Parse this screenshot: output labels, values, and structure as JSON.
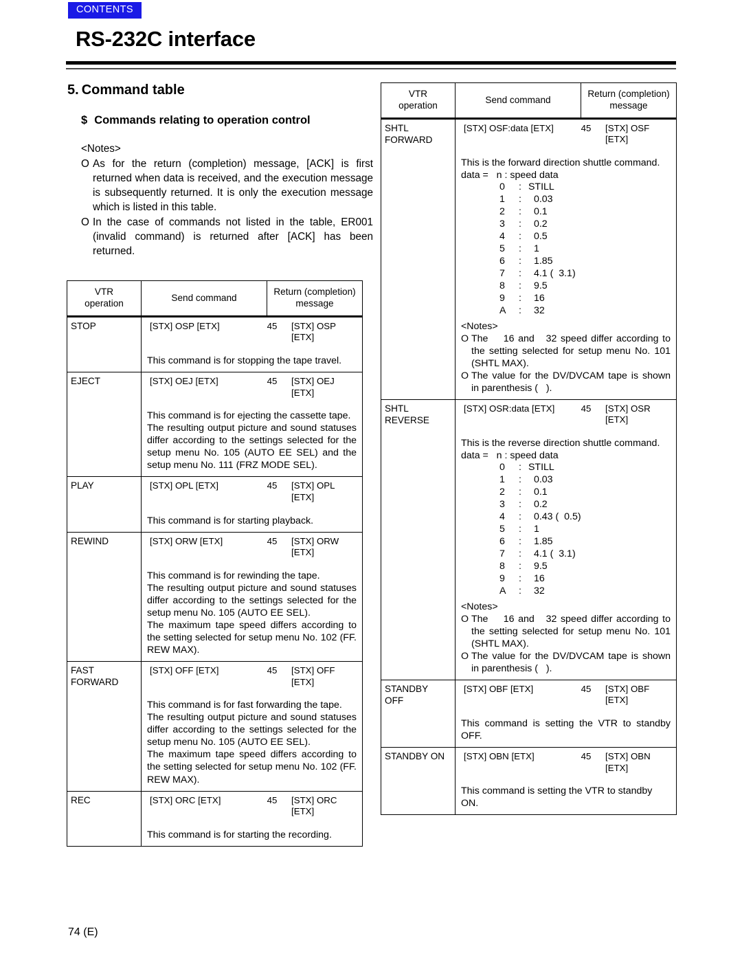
{
  "header": {
    "contents_badge": "CONTENTS",
    "title": "RS-232C interface"
  },
  "section": {
    "number": "5.",
    "heading": "Command table",
    "sub_bullet": "$",
    "sub_heading": "Commands relating to operation control"
  },
  "notes": {
    "title": "<Notes>",
    "mark": "O",
    "items": [
      "As for the return (completion) message, [ACK] is first returned when data is received, and the execution message is subsequently returned. It is only the execution message which is listed in this table.",
      "In the case of commands not listed in the table, ER001 (invalid command) is returned after [ACK] has been returned."
    ]
  },
  "table_header": {
    "col1_line1": "VTR",
    "col1_line2": "operation",
    "col2": "Send command",
    "col3_line1": "Return (completion)",
    "col3_line2": "message"
  },
  "arrow_symbol": "45",
  "left_table": {
    "rows": [
      {
        "operation": "STOP",
        "send": "[STX] OSP [ETX]",
        "arrow": "45",
        "return": "[STX] OSP [ETX]",
        "desc": [
          "This command is for stopping the tape travel."
        ]
      },
      {
        "operation": "EJECT",
        "send": "[STX] OEJ [ETX]",
        "arrow": "45",
        "return": "[STX] OEJ [ETX]",
        "desc": [
          "This command is for ejecting the cassette tape.",
          "The resulting output picture and sound statuses differ according to the settings selected for the setup menu No. 105 (AUTO EE SEL) and the setup menu No. 111 (FRZ MODE SEL)."
        ]
      },
      {
        "operation": "PLAY",
        "send": "[STX] OPL [ETX]",
        "arrow": "45",
        "return": "[STX] OPL [ETX]",
        "desc": [
          "This command is for starting playback."
        ]
      },
      {
        "operation": "REWIND",
        "send": "[STX] ORW [ETX]",
        "arrow": "45",
        "return": "[STX] ORW [ETX]",
        "desc": [
          "This command is for rewinding the tape.",
          "The resulting output picture and sound statuses differ according to the settings selected for the setup menu No. 105 (AUTO EE SEL).",
          "The maximum tape speed differs according to the setting selected for setup menu No. 102 (FF. REW MAX)."
        ]
      },
      {
        "operation": "FAST\nFORWARD",
        "send": "[STX] OFF [ETX]",
        "arrow": "45",
        "return": "[STX] OFF [ETX]",
        "desc": [
          "This command is for fast forwarding the tape.",
          "The resulting output picture and sound statuses differ according to the settings selected for the setup menu No. 105 (AUTO EE SEL).",
          "The maximum tape speed differs according to the setting selected for setup menu No. 102 (FF. REW MAX)."
        ]
      },
      {
        "operation": "REC",
        "send": "[STX] ORC [ETX]",
        "arrow": "45",
        "return": "[STX] ORC [ETX]",
        "desc": [
          "This command is for starting the recording."
        ]
      }
    ]
  },
  "right_table": {
    "rows": [
      {
        "operation": "SHTL\nFORWARD",
        "send": "[STX] OSF:data [ETX]",
        "arrow": "45",
        "return": "[STX] OSF [ETX]",
        "desc": [
          "This is the forward direction shuttle command."
        ],
        "data_label": "data =   n : speed data",
        "speeds": [
          {
            "key": "0",
            "value": "STILL"
          },
          {
            "key": "1",
            "value": "0.03"
          },
          {
            "key": "2",
            "value": "0.1"
          },
          {
            "key": "3",
            "value": "0.2"
          },
          {
            "key": "4",
            "value": "0.5"
          },
          {
            "key": "5",
            "value": "1"
          },
          {
            "key": "6",
            "value": "1.85"
          },
          {
            "key": "7",
            "value": "4.1 (  3.1)"
          },
          {
            "key": "8",
            "value": "9.5"
          },
          {
            "key": "9",
            "value": "16"
          },
          {
            "key": "A",
            "value": "32"
          }
        ],
        "notes_title": "<Notes>",
        "notes_mark": "O",
        "notes": [
          "The    16 and   32 speed differ according to the setting selected for setup menu No. 101 (SHTL MAX).",
          "The value for the DV/DVCAM tape is shown in parenthesis (   )."
        ]
      },
      {
        "operation": "SHTL\nREVERSE",
        "send": "[STX] OSR:data [ETX]",
        "arrow": "45",
        "return": "[STX] OSR [ETX]",
        "desc": [
          "This is the reverse direction shuttle command."
        ],
        "data_label": "data =   n : speed data",
        "speeds": [
          {
            "key": "0",
            "value": "STILL"
          },
          {
            "key": "1",
            "value": "0.03"
          },
          {
            "key": "2",
            "value": "0.1"
          },
          {
            "key": "3",
            "value": "0.2"
          },
          {
            "key": "4",
            "value": "0.43 (  0.5)"
          },
          {
            "key": "5",
            "value": "1"
          },
          {
            "key": "6",
            "value": "1.85"
          },
          {
            "key": "7",
            "value": "4.1 (  3.1)"
          },
          {
            "key": "8",
            "value": "9.5"
          },
          {
            "key": "9",
            "value": "16"
          },
          {
            "key": "A",
            "value": "32"
          }
        ],
        "notes_title": "<Notes>",
        "notes_mark": "O",
        "notes": [
          "The    16 and   32 speed differ according to the setting selected for setup menu No. 101 (SHTL MAX).",
          "The value for the DV/DVCAM tape is shown in parenthesis (   )."
        ]
      },
      {
        "operation": "STANDBY\nOFF",
        "send": "[STX] OBF [ETX]",
        "arrow": "45",
        "return": "[STX] OBF [ETX]",
        "desc": [
          "This command is setting the VTR to standby OFF."
        ]
      },
      {
        "operation": "STANDBY ON",
        "send": "[STX] OBN [ETX]",
        "arrow": "45",
        "return": "[STX] OBN [ETX]",
        "desc": [
          "This command is setting the VTR to standby ON."
        ]
      }
    ]
  },
  "footer": {
    "page_number": "74 (E)"
  },
  "colors": {
    "contents_badge_bg": "#1a1ae6",
    "rule": "#000000",
    "text": "#000000"
  }
}
